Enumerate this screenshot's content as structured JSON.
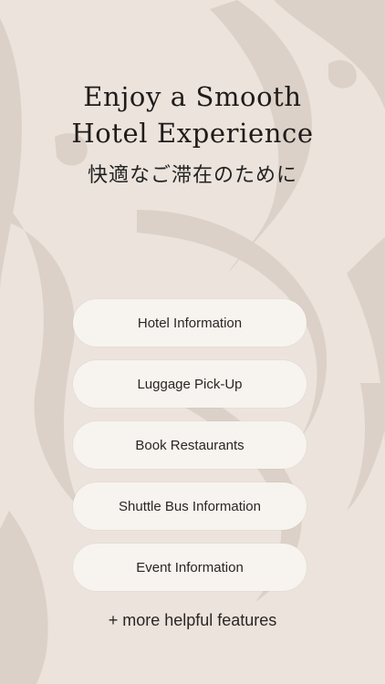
{
  "hero": {
    "title_line1": "Enjoy a Smooth",
    "title_line2": "Hotel Experience",
    "subtitle": "快適なご滞在のために"
  },
  "menu": {
    "items": [
      {
        "label": "Hotel Information"
      },
      {
        "label": "Luggage Pick-Up"
      },
      {
        "label": "Book Restaurants"
      },
      {
        "label": "Shuttle Bus Information"
      },
      {
        "label": "Event Information"
      }
    ]
  },
  "footer": {
    "more_label": "+ more helpful features"
  },
  "colors": {
    "background": "#ebe3dc",
    "button_fill": "#f7f3ee",
    "brush_strokes": "#d8cdc4",
    "text": "#1f1b19"
  }
}
